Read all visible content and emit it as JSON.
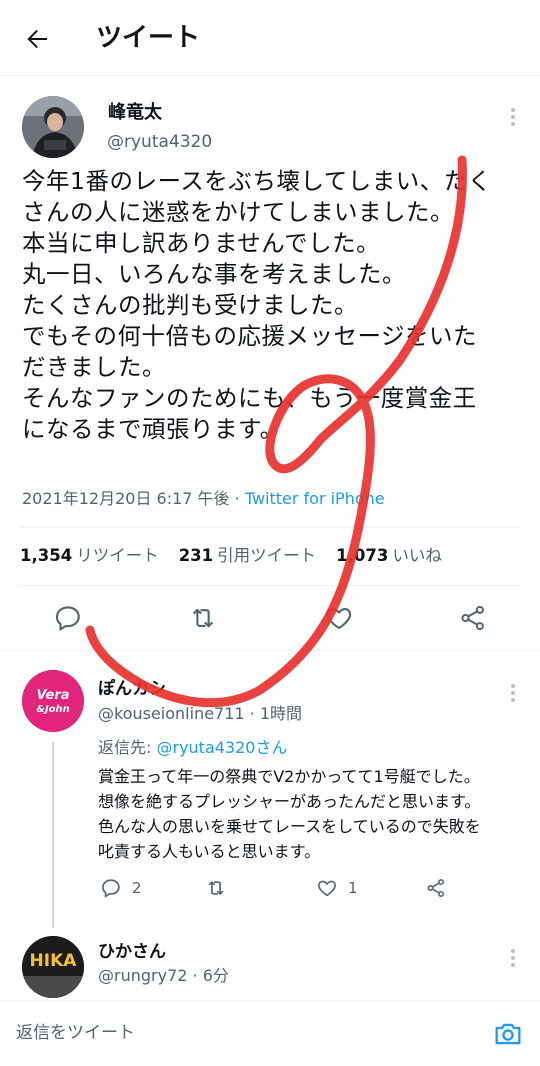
{
  "header": {
    "title": "ツイート"
  },
  "tweet": {
    "author_name": "峰竜太",
    "author_handle": "@ryuta4320",
    "lines": [
      "今年1番のレースをぶち壊してしまい、たく",
      "さんの人に迷惑をかけてしまいました。",
      "本当に申し訳ありませんでした。",
      "丸一日、いろんな事を考えました。",
      "たくさんの批判も受けました。",
      "でもその何十倍もの応援メッセージをいた",
      "だきました。",
      "そんなファンのためにも、もう一度賞金王",
      "になるまで頑張ります。"
    ],
    "timestamp": "2021年12月20日 6:17 午後",
    "separator": " · ",
    "source": "Twitter for iPhone",
    "retweets_count": "1,354",
    "retweets_label": "リツイート",
    "quotes_count": "231",
    "quotes_label": "引用ツイート",
    "likes_count": "1,073",
    "likes_label": "いいね"
  },
  "replies": [
    {
      "name": "ぽんカシ",
      "handle": "@kouseionline711",
      "time": "1時間",
      "reply_to_prefix": "返信先: ",
      "reply_to": "@ryuta4320さん",
      "lines": [
        "賞金王って年一の祭典でV2かかってて1号艇でした。",
        "想像を絶するプレッシャーがあったんだと思います。",
        "色んな人の思いを乗せてレースをしているので失敗を",
        "叱責する人もいると思います。"
      ],
      "reply_count": "2",
      "like_count": "1",
      "avatar_text_1": "Vera",
      "avatar_text_2": "&John"
    },
    {
      "name": "ひかさん",
      "handle": "@rungry72",
      "time": "6分",
      "avatar_text": "HIKA"
    }
  ],
  "bottom_bar": {
    "placeholder": "返信をツイート"
  },
  "colors": {
    "accent": "#1d9bf0",
    "scribble": "#e8322f"
  }
}
